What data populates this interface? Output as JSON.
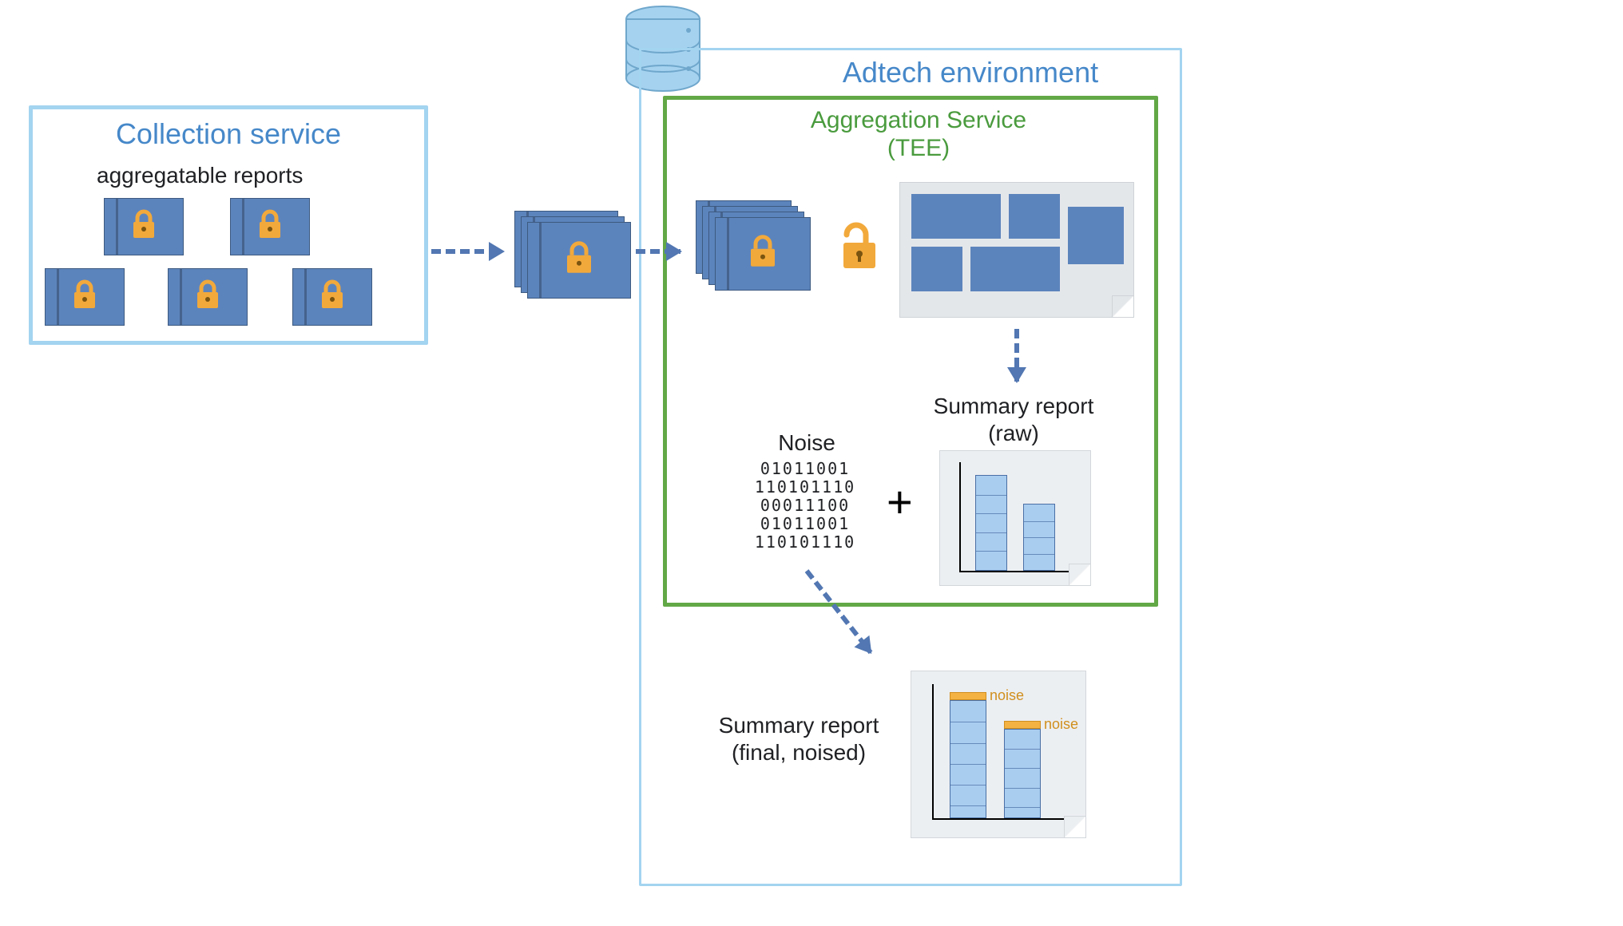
{
  "collection": {
    "title": "Collection service",
    "subtitle": "aggregatable reports"
  },
  "adtech": {
    "title": "Adtech environment"
  },
  "aggregation": {
    "title": "Aggregation Service\n(TEE)"
  },
  "noise": {
    "label": "Noise",
    "bits": "01011001\n110101110\n00011100\n01011001\n110101110"
  },
  "plus": "+",
  "summary_raw": {
    "label": "Summary report\n(raw)"
  },
  "summary_final": {
    "label": "Summary report\n(final, noised)",
    "noise_tag": "noise"
  },
  "icons": {
    "locked_doc": "lock-icon",
    "open_lock": "unlock-icon",
    "database": "database-icon"
  },
  "colors": {
    "border_light_blue": "#a3d4f0",
    "border_green": "#62a846",
    "fill_blue": "#5c84bc",
    "accent_orange": "#f4b243",
    "title_blue": "#4688c9"
  }
}
